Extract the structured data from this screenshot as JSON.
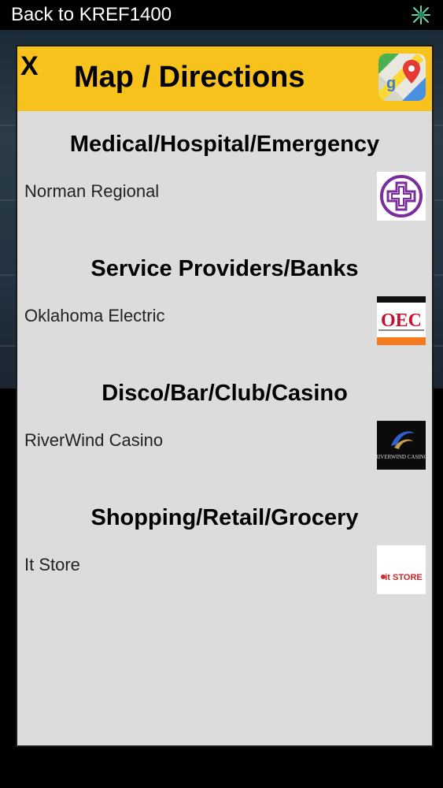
{
  "topbar": {
    "back_label": "Back to KREF1400"
  },
  "modal": {
    "close_label": "X",
    "title": "Map / Directions"
  },
  "sections": [
    {
      "title": "Medical/Hospital/Emergency",
      "item_label": "Norman Regional",
      "logo": "norman-regional-logo"
    },
    {
      "title": "Service Providers/Banks",
      "item_label": "Oklahoma Electric",
      "logo": "oec-logo",
      "logo_text": "OEC"
    },
    {
      "title": "Disco/Bar/Club/Casino",
      "item_label": "RiverWind Casino",
      "logo": "riverwind-logo",
      "logo_text": "RIVERWIND CASINO"
    },
    {
      "title": "Shopping/Retail/Grocery",
      "item_label": "It Store",
      "logo": "it-store-logo",
      "logo_text": "it STORE"
    }
  ],
  "colors": {
    "header": "#f7c21c",
    "modal_bg": "#dcdcdc",
    "norman_purple": "#7b2d9b",
    "oec_red": "#c8102e",
    "oec_orange": "#f47b20"
  }
}
